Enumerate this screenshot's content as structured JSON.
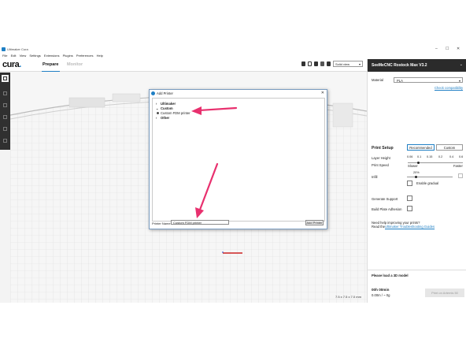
{
  "window": {
    "title": "Ultimaker Cura",
    "controls": [
      "–",
      "☐",
      "✕"
    ]
  },
  "menu": [
    "File",
    "Edit",
    "View",
    "Settings",
    "Extensions",
    "Plugins",
    "Preferences",
    "Help"
  ],
  "header": {
    "logo": "cura",
    "logo_dot": ".",
    "tabs": [
      "Prepare",
      "Monitor"
    ],
    "view_mode": "Solid view"
  },
  "dialog": {
    "title": "Add Printer",
    "close": "✕",
    "tree": [
      {
        "arrow": "›",
        "label": "Ultimaker"
      },
      {
        "arrow": "⌄",
        "label": "Custom"
      },
      {
        "label": "Custom FDM printer"
      },
      {
        "arrow": "›",
        "label": "Other"
      }
    ],
    "printer_name_label": "Printer Name:",
    "printer_name_value": "Custom FDM printer",
    "add_button": "Add Printer"
  },
  "viewport": {
    "dimensions": "7.5 x 7.5 x 7.0 mm"
  },
  "sidebar": {
    "machine_name": "SeeMeCNC Rostock Max V3.2",
    "material_label": "Material",
    "material_value": "PLA",
    "check_compat": "Check compatibility",
    "print_setup": "Print Setup",
    "modes": [
      "Recommended",
      "Custom"
    ],
    "layer_height_label": "Layer Height",
    "layer_heights": [
      "0.06",
      "0.1",
      "0.15",
      "0.2",
      "0.4",
      "0.6"
    ],
    "print_speed_label": "Print Speed",
    "slower": "Slower",
    "faster": "Faster",
    "infill_label": "Infill",
    "infill_value": "20%",
    "enable_gradual": "Enable gradual",
    "generate_support": "Generate Support",
    "build_plate_adhesion": "Build Plate Adhesion",
    "help_text": "Need help improving your prints?",
    "read_the": "Read the",
    "guides_link": "Ultimaker Troubleshooting Guides",
    "load_model": "Please load a 3D model",
    "time": "00h 00min",
    "material_usage": "0.00m / ~ 0g",
    "print_button": "Print on Artemis 50"
  },
  "colors": {
    "accent": "#1f7fc4",
    "arrow": "#e8306e",
    "sidebar_header": "#2b2b2b"
  }
}
